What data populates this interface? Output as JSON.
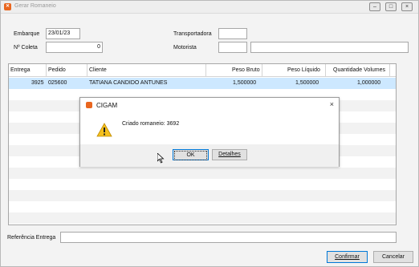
{
  "window": {
    "title": "Gerar Romaneio",
    "app_icon": "cigam-logo-icon",
    "controls": [
      "minimize-icon",
      "maximize-icon",
      "close-icon"
    ],
    "close_glyph": "×"
  },
  "form": {
    "embarque_label": "Embarque",
    "embarque_value": "23/01/23",
    "coleta_label": "Nº Coleta",
    "coleta_value": "0",
    "transportadora_label": "Transportadora",
    "transportadora_value": "",
    "motorista_label": "Motorista",
    "motorista_code": "",
    "motorista_name": ""
  },
  "grid": {
    "columns": [
      "Entrega",
      "Pedido",
      "Cliente",
      "Peso Bruto",
      "Peso Líquido",
      "Quantidade Volumes"
    ],
    "rows": [
      {
        "entrega": "3925",
        "pedido": "025600",
        "cliente": "TATIANA CANDIDO ANTUNES",
        "peso_bruto": "1,500000",
        "peso_liquido": "1,500000",
        "quantidade_volumes": "1,000000"
      }
    ]
  },
  "referencia": {
    "label": "Referência Entrega",
    "value": ""
  },
  "buttons": {
    "confirmar": "Confirmar",
    "cancelar": "Cancelar"
  },
  "dialog": {
    "title": "CIGAM",
    "close_glyph": "×",
    "icon": "warning-icon",
    "message": "Criado romaneio: 3692",
    "ok_label": "OK",
    "detalhes_label": "Detalhes"
  },
  "colors": {
    "accent": "#e9661f",
    "selection": "#cde8ff",
    "focus_border": "#0078d7"
  }
}
